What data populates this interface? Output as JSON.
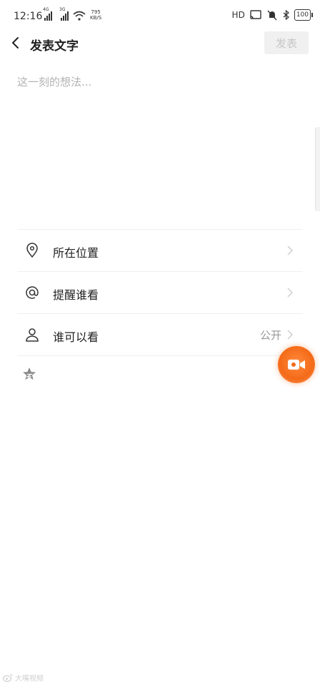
{
  "status_bar": {
    "time": "12:16",
    "sim1_tag": "4G",
    "sim2_tag": "3G",
    "speed_value": "795",
    "speed_unit": "KB/S",
    "hd": "HD",
    "battery": "100"
  },
  "header": {
    "title": "发表文字",
    "publish_label": "发表"
  },
  "editor": {
    "placeholder": "这一刻的想法..."
  },
  "options": [
    {
      "icon": "location-pin-icon",
      "label": "所在位置",
      "value": ""
    },
    {
      "icon": "at-sign-icon",
      "label": "提醒谁看",
      "value": ""
    },
    {
      "icon": "person-icon",
      "label": "谁可以看",
      "value": "公开"
    }
  ],
  "colors": {
    "accent": "#f46a18",
    "muted_text": "#b2b2b2",
    "divider": "#efefef"
  },
  "watermark": {
    "text": "大嘴视频"
  }
}
